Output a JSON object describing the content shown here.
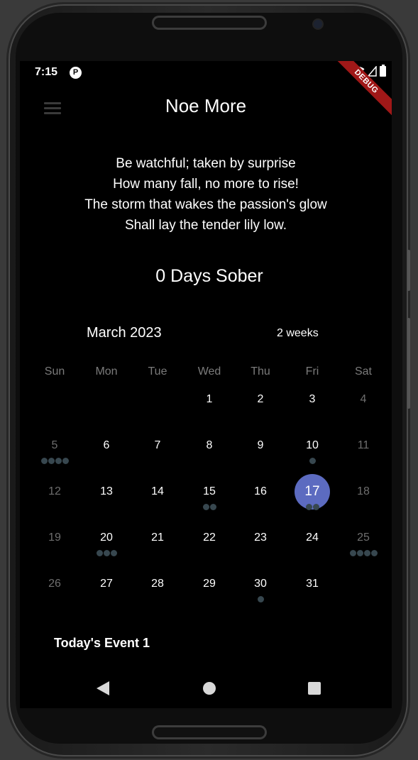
{
  "status_bar": {
    "time": "7:15",
    "app_icon_glyph": "P",
    "icons": [
      "wifi-icon",
      "signal-icon",
      "battery-icon"
    ]
  },
  "debug_banner": "DEBUG",
  "app_bar": {
    "title": "Noe More",
    "menu_icon": "hamburger-menu-icon"
  },
  "poem": [
    "Be watchful; taken by surprise",
    "How many fall, no more to rise!",
    "The storm that wakes the passion's glow",
    "Shall lay the tender lily low."
  ],
  "sobriety": {
    "label": "0 Days Sober"
  },
  "calendar": {
    "month_label": "March 2023",
    "format_button": "2 weeks",
    "weekdays": [
      "Sun",
      "Mon",
      "Tue",
      "Wed",
      "Thu",
      "Fri",
      "Sat"
    ],
    "weeks": [
      [
        null,
        null,
        null,
        "1",
        "2",
        "3",
        "4"
      ],
      [
        "5",
        "6",
        "7",
        "8",
        "9",
        "10",
        "11"
      ],
      [
        "12",
        "13",
        "14",
        "15",
        "16",
        "17",
        "18"
      ],
      [
        "19",
        "20",
        "21",
        "22",
        "23",
        "24",
        "25"
      ],
      [
        "26",
        "27",
        "28",
        "29",
        "30",
        "31",
        null
      ]
    ],
    "selected_day": "17",
    "event_markers": {
      "5": 4,
      "10": 1,
      "15": 2,
      "17": 2,
      "20": 3,
      "25": 4,
      "30": 1
    },
    "colors": {
      "selected": "#5c6bc0",
      "marker": "#37474f",
      "weekend_text": "#6e6e6e"
    }
  },
  "events": {
    "title": "Today's Event 1"
  },
  "nav_bar": {
    "icons": [
      "back-icon",
      "home-icon",
      "recents-icon"
    ]
  }
}
